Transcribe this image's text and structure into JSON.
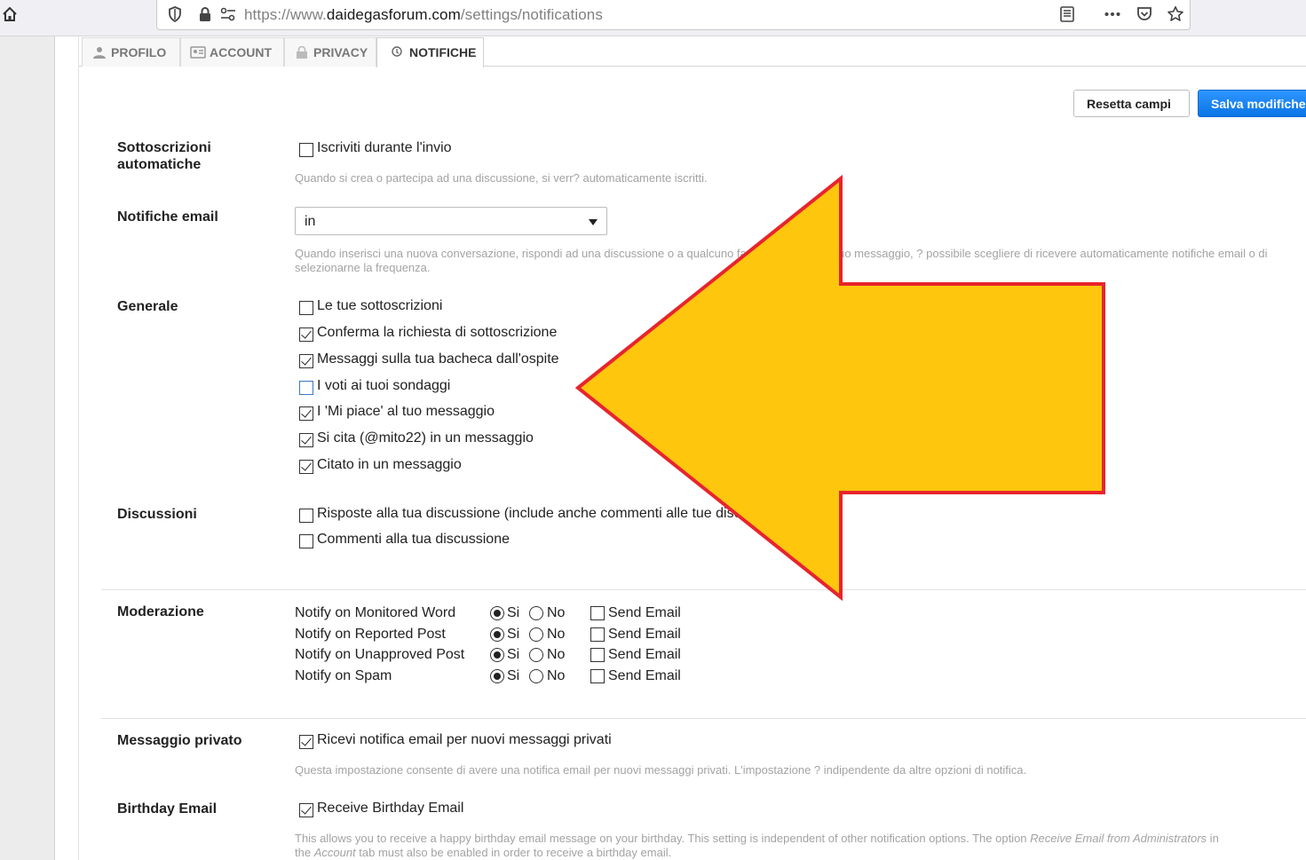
{
  "browser": {
    "url_prefix": "https://www.",
    "url_domain": "daidegasforum.com",
    "url_path": "/settings/notifications"
  },
  "tabs": [
    {
      "label": "PROFILO"
    },
    {
      "label": "ACCOUNT"
    },
    {
      "label": "PRIVACY"
    },
    {
      "label": "NOTIFICHE",
      "active": true
    }
  ],
  "actions": {
    "reset_label": "Resetta campi",
    "save_label": "Salva modifiche"
  },
  "auto_subscriptions": {
    "label": "Sottoscrizioni automatiche",
    "label_line1": "Sottoscrizioni",
    "label_line2": "automatiche",
    "checkbox_label": "Iscriviti durante l'invio",
    "checked": false,
    "hint": "Quando si crea o partecipa ad una discussione, si verr? automaticamente iscritti."
  },
  "email_notifications": {
    "label": "Notifiche email",
    "selected": "in",
    "hint_line1": "Quando inserisci una nuova conversazione, rispondi ad una discussione o a qualcuno fa un commento al tuo messaggio, ? possibile scegliere di ricevere automaticamente notifiche email o di",
    "hint_line2": "selezionarne la frequenza."
  },
  "general": {
    "label": "Generale",
    "items": [
      {
        "label": "Le tue sottoscrizioni",
        "checked": false
      },
      {
        "label": "Conferma la richiesta di sottoscrizione",
        "checked": true
      },
      {
        "label": "Messaggi sulla tua bacheca dall'ospite",
        "checked": true
      },
      {
        "label": "I voti ai tuoi sondaggi",
        "checked": false
      },
      {
        "label": "I 'Mi piace' al tuo messaggio",
        "checked": true
      },
      {
        "label": "Si cita (@mito22) in un messaggio",
        "checked": true
      },
      {
        "label": "Citato in un messaggio",
        "checked": true
      }
    ]
  },
  "discussions": {
    "label": "Discussioni",
    "items": [
      {
        "label": "Risposte alla tua discussione (include anche commenti alle tue discussioni)",
        "checked": false
      },
      {
        "label": "Commenti alla tua discussione",
        "checked": false
      }
    ]
  },
  "moderation": {
    "label": "Moderazione",
    "yes_label": "Si",
    "no_label": "No",
    "send_label": "Send Email",
    "rows": [
      {
        "label": "Notify on Monitored Word",
        "value": "Si",
        "send_email": false
      },
      {
        "label": "Notify on Reported Post",
        "value": "Si",
        "send_email": false
      },
      {
        "label": "Notify on Unapproved Post",
        "value": "Si",
        "send_email": false
      },
      {
        "label": "Notify on Spam",
        "value": "Si",
        "send_email": false
      }
    ]
  },
  "private_message": {
    "label": "Messaggio privato",
    "checkbox_label": "Ricevi notifica email per nuovi messaggi privati",
    "checked": true,
    "hint": "Questa impostazione consente di avere una notifica email per nuovi messaggi privati. L'impostazione ? indipendente da altre opzioni di notifica."
  },
  "birthday_email": {
    "label": "Birthday Email",
    "checkbox_label": "Receive Birthday Email",
    "checked": true,
    "hint_a": "This allows you to receive a happy birthday email message on your birthday. This setting is independent of other notification options. The option ",
    "hint_em1": "Receive Email from Administrators",
    "hint_b": " in",
    "hint_c": "the ",
    "hint_em2": "Account",
    "hint_d": " tab must also be enabled in order to receive a birthday email."
  },
  "annotation": {
    "arrow_color": "#fec60d",
    "arrow_stroke": "#e8242c"
  }
}
